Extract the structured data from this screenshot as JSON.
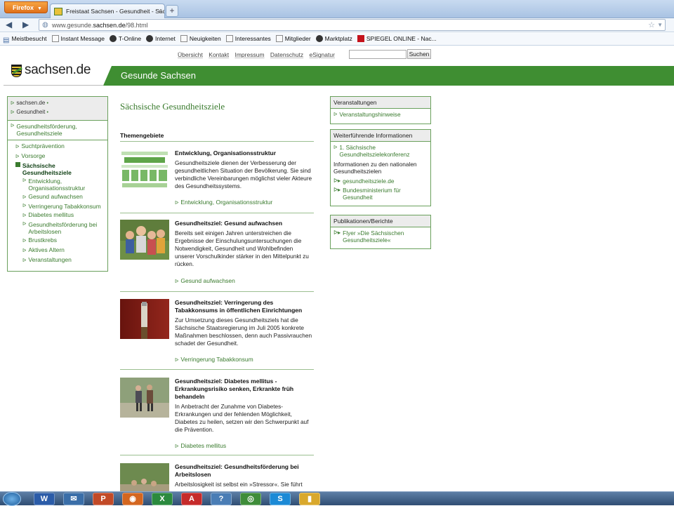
{
  "browser": {
    "menu_button": "Firefox",
    "tab_title": "Freistaat Sachsen - Gesundheit - Sächsi...",
    "tab_close": "×",
    "new_tab": "+",
    "url_prefix": "www.gesunde.",
    "url_domain": "sachsen.de",
    "url_suffix": "/98.html",
    "bookmarks": [
      {
        "label": "Meistbesucht",
        "icon": "meistbesucht-icon"
      },
      {
        "label": "Instant Message",
        "icon": "page-icon"
      },
      {
        "label": "T-Online",
        "icon": "tonline-icon"
      },
      {
        "label": "Internet",
        "icon": "tonline-icon"
      },
      {
        "label": "Neuigkeiten",
        "icon": "page-icon"
      },
      {
        "label": "Interessantes",
        "icon": "page-icon"
      },
      {
        "label": "Mitglieder",
        "icon": "page-icon"
      },
      {
        "label": "Marktplatz",
        "icon": "tonline-icon"
      },
      {
        "label": "SPIEGEL ONLINE - Nac...",
        "icon": "spiegel-icon"
      }
    ]
  },
  "site": {
    "utility_nav": [
      "Übersicht",
      "Kontakt",
      "Impressum",
      "Datenschutz",
      "eSignatur"
    ],
    "search_button": "Suchen",
    "logo_text": "sachsen.de",
    "banner_title": "Gesunde Sachsen"
  },
  "leftnav": {
    "crumbs": [
      "sachsen.de",
      "Gesundheit"
    ],
    "section": "Gesundheitsförderung, Gesundheitsziele",
    "items": [
      "Suchtprävention",
      "Vorsorge"
    ],
    "active": "Sächsische Gesundheitsziele",
    "subitems": [
      "Entwicklung, Organisationsstruktur",
      "Gesund aufwachsen",
      "Verringerung Tabakkonsum",
      "Diabetes mellitus",
      "Gesundheitsförderung bei Arbeitslosen",
      "Brustkrebs",
      "Aktives Altern",
      "Veranstaltungen"
    ]
  },
  "main": {
    "title": "Sächsische Gesundheitsziele",
    "subtitle": "Themengebiete",
    "articles": [
      {
        "heading": "Entwicklung, Organisationsstruktur",
        "text": "Gesundheitsziele dienen der Verbesserung der gesundheitlichen Situation der Bevölkerung. Sie sind verbindliche Vereinbarungen möglichst vieler Akteure des Gesundheitssystems.",
        "link": "Entwicklung, Organisationsstruktur"
      },
      {
        "heading": "Gesundheitsziel: Gesund aufwachsen",
        "text": "Bereits seit einigen Jahren unterstreichen die Ergebnisse der Einschulungsuntersuchungen die Notwendigkeit, Gesundheit und Wohlbefinden unserer Vorschulkinder stärker in den Mittelpunkt zu rücken.",
        "link": "Gesund aufwachsen"
      },
      {
        "heading": "Gesundheitsziel: Verringerung des Tabakkonsums in öffentlichen Einrichtungen",
        "text": "Zur Umsetzung dieses Gesundheitsziels hat die Sächsische Staatsregierung im Juli 2005 konkrete Maßnahmen beschlossen, denn auch Passivrauchen schadet der Gesundheit.",
        "link": "Verringerung Tabakkonsum"
      },
      {
        "heading": "Gesundheitsziel: Diabetes mellitus - Erkrankungsrisiko senken, Erkrankte früh behandeln",
        "text": "In Anbetracht der Zunahme von Diabetes-Erkrankungen und der fehlenden Möglichkeit, Diabetes zu heilen, setzen wir den Schwerpunkt auf die Prävention.",
        "link": "Diabetes mellitus"
      },
      {
        "heading": "Gesundheitsziel: Gesundheitsförderung bei Arbeitslosen",
        "text": "Arbeitslosigkeit ist selbst ein »Stressor«. Sie führt",
        "link": ""
      }
    ]
  },
  "right": {
    "box1": {
      "title": "Veranstaltungen",
      "link": "Veranstaltungshinweise"
    },
    "box2": {
      "title": "Weiterführende Informationen",
      "link1": "1. Sächsische Gesundheitszielekonferenz",
      "text": "Informationen zu den nationalen Gesundheitszielen",
      "ext1": "gesundheitsziele.de",
      "ext2": "Bundesministerium für Gesundheit"
    },
    "box3": {
      "title": "Publikationen/Berichte",
      "link": "Flyer »Die Sächsischen Gesundheitsziele«"
    }
  },
  "colors": {
    "brand_green": "#3f8e32",
    "link_green": "#3a7b2e",
    "firefox_orange": "#e0701a"
  }
}
